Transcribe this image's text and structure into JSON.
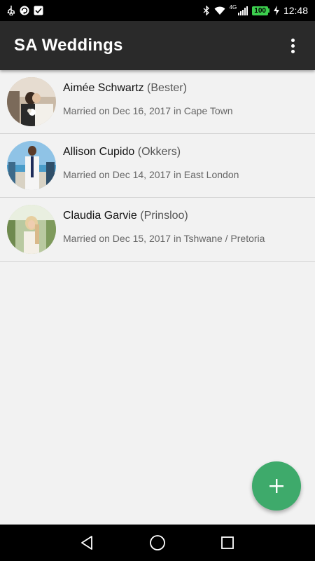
{
  "status_bar": {
    "time": "12:48",
    "battery": "100",
    "network": "4G",
    "icons": [
      "usb-icon",
      "sync-icon",
      "check-icon",
      "bluetooth-icon",
      "wifi-icon",
      "signal-icon",
      "battery-icon",
      "charging-icon"
    ]
  },
  "app_bar": {
    "title": "SA Weddings",
    "overflow_icon": "more-vert-icon"
  },
  "weddings": [
    {
      "name": "Aimée Schwartz",
      "maiden": "(Bester)",
      "subtitle": "Married on Dec 16, 2017 in Cape Town"
    },
    {
      "name": "Allison Cupido",
      "maiden": "(Okkers)",
      "subtitle": "Married on Dec 14, 2017 in East London"
    },
    {
      "name": "Claudia Garvie",
      "maiden": "(Prinsloo)",
      "subtitle": "Married on Dec 15, 2017 in Tshwane / Pretoria"
    }
  ],
  "fab": {
    "icon": "add-icon"
  },
  "nav_bar": {
    "icons": [
      "back-icon",
      "home-icon",
      "recents-icon"
    ]
  },
  "colors": {
    "app_bar": "#2a2a2a",
    "fab": "#3eaa6b",
    "background": "#f2f2f2"
  }
}
